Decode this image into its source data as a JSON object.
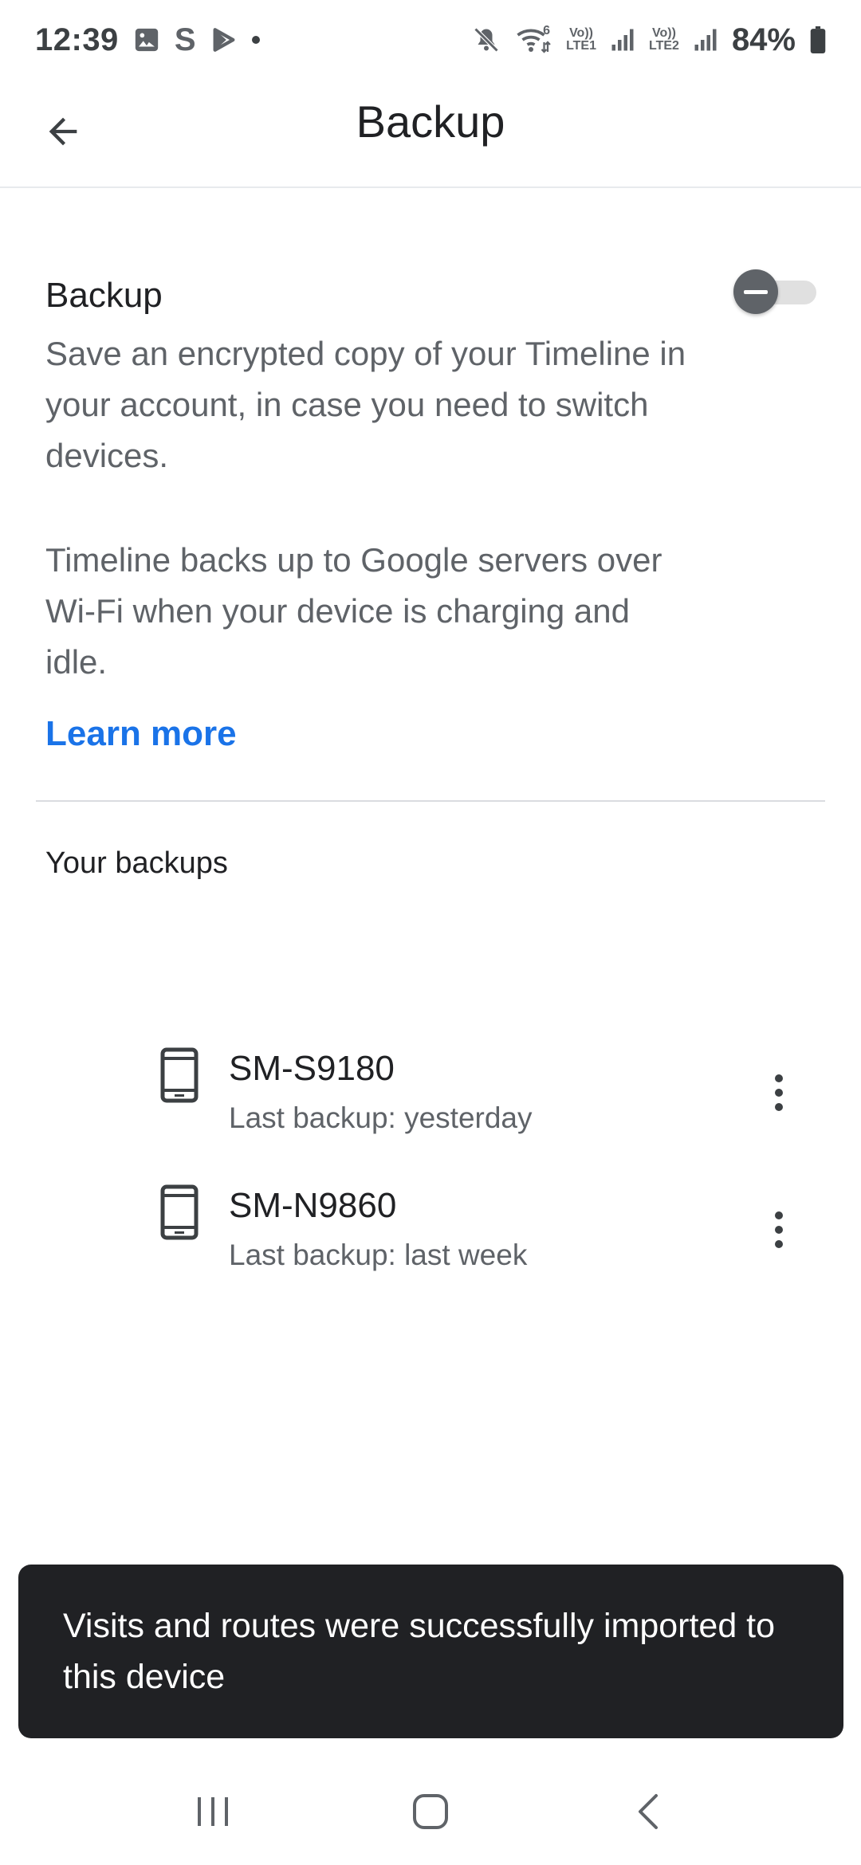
{
  "status_bar": {
    "time": "12:39",
    "notification_icons": [
      "gallery-icon",
      "s-icon",
      "play-store-icon",
      "dot-icon"
    ],
    "s_glyph": "S",
    "system_icons": [
      "mute-icon",
      "wifi-icon",
      "lte1-signal-icon",
      "lte2-signal-icon",
      "battery-icon"
    ],
    "wifi_label": "6",
    "lte1_label_top": "Vo))",
    "lte1_label_bottom": "LTE1",
    "lte2_label_top": "Vo))",
    "lte2_label_bottom": "LTE2",
    "battery": "84%"
  },
  "app_bar": {
    "title": "Backup",
    "back_icon": "arrow-back-icon"
  },
  "backup_section": {
    "heading": "Backup",
    "toggle_on": false,
    "description_1": "Save an encrypted copy of your Timeline in your account, in case you need to switch devices.",
    "description_2": "Timeline backs up to Google servers over Wi-Fi when your device is charging and idle.",
    "learn_more": "Learn more"
  },
  "backups_list": {
    "heading": "Your backups",
    "items": [
      {
        "name": "SM-S9180",
        "subtitle": "Last backup: yesterday",
        "icon": "phone-icon"
      },
      {
        "name": "SM-N9860",
        "subtitle": "Last backup: last week",
        "icon": "phone-icon"
      }
    ]
  },
  "snackbar": {
    "message": "Visits and routes were successfully imported to this device"
  },
  "nav_bar": {
    "buttons": [
      "recents-icon",
      "home-icon",
      "back-icon"
    ]
  },
  "colors": {
    "link": "#1a73e8",
    "text_primary": "#202124",
    "text_secondary": "#5f6368",
    "snackbar_bg": "#202124",
    "toggle_thumb": "#5f6368",
    "toggle_track": "#e0e0e0"
  }
}
